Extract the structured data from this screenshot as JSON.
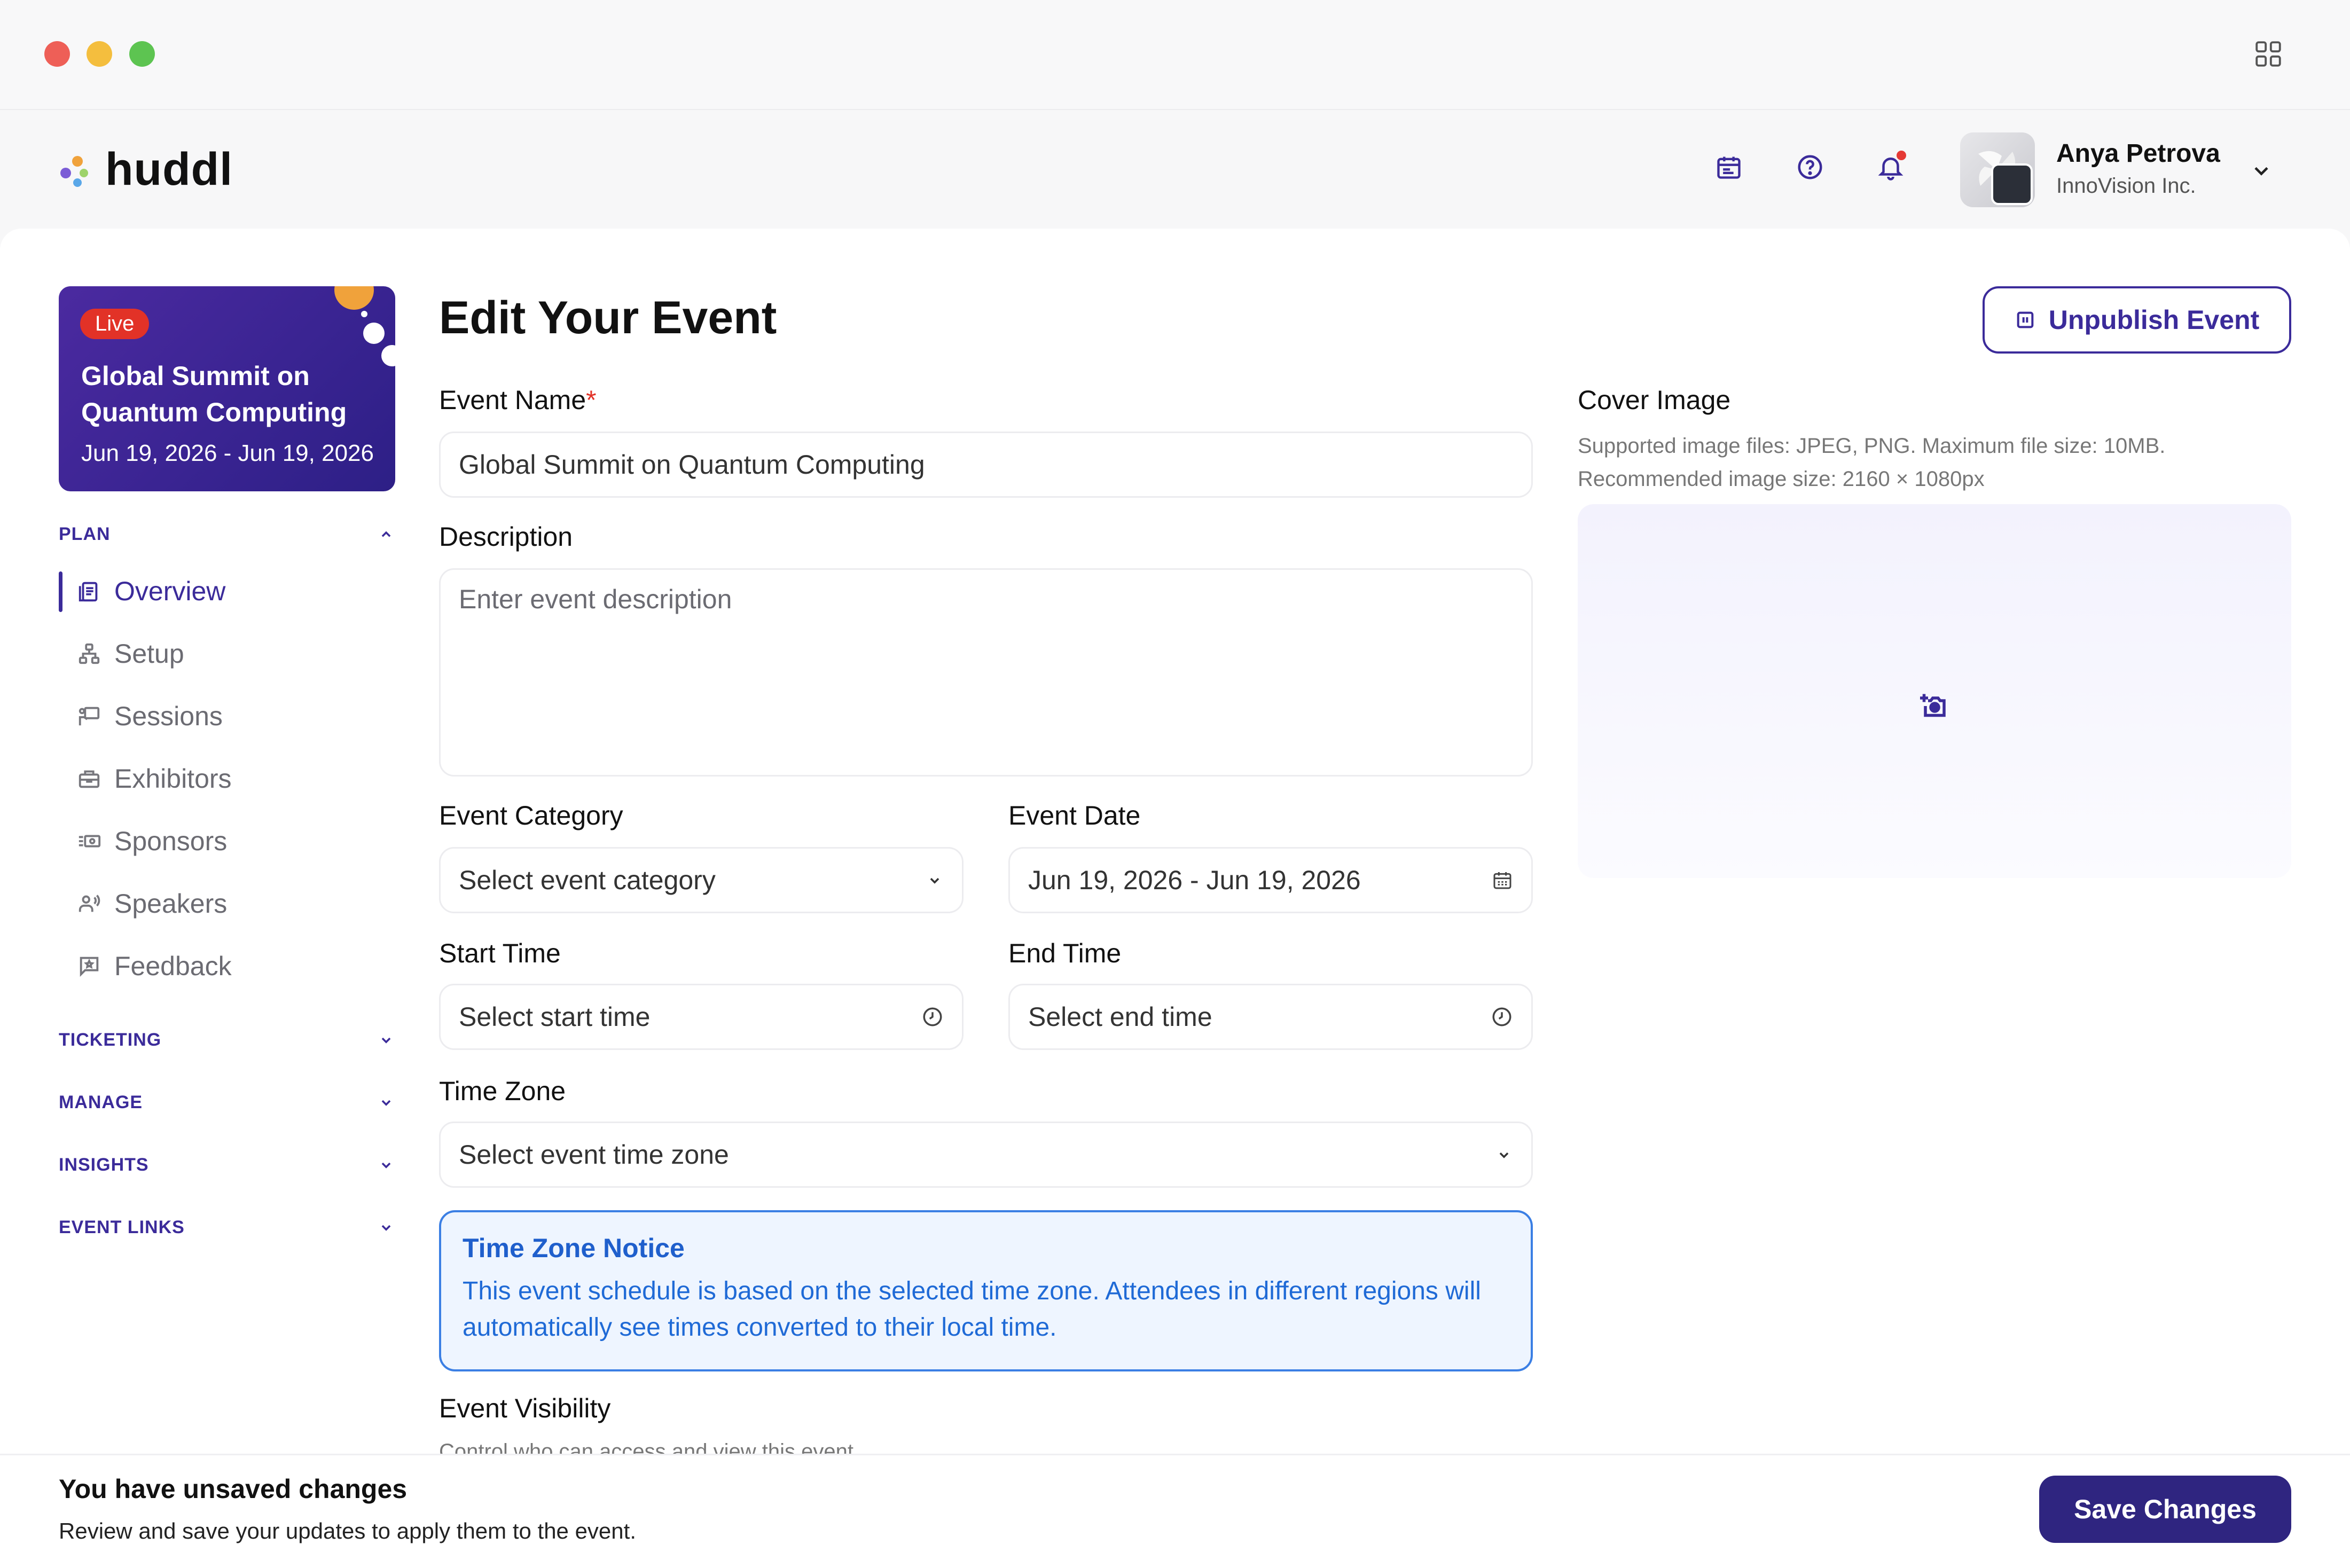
{
  "colors": {
    "accent": "#3b2b9a",
    "live": "#e23227",
    "notice_border": "#3b7fe4",
    "notice_bg": "#eef5ff"
  },
  "brand": {
    "name": "huddl"
  },
  "user": {
    "name": "Anya Petrova",
    "org": "InnoVision Inc."
  },
  "event_card": {
    "badge": "Live",
    "title": "Global Summit on Quantum Computing",
    "date": "Jun 19, 2026 - Jun 19, 2026"
  },
  "sidebar": {
    "plan_label": "PLAN",
    "items": [
      {
        "label": "Overview",
        "icon": "clipboard-icon",
        "active": true
      },
      {
        "label": "Setup",
        "icon": "sitemap-icon"
      },
      {
        "label": "Sessions",
        "icon": "presentation-icon"
      },
      {
        "label": "Exhibitors",
        "icon": "booth-icon"
      },
      {
        "label": "Sponsors",
        "icon": "money-icon"
      },
      {
        "label": "Speakers",
        "icon": "speaker-icon"
      },
      {
        "label": "Feedback",
        "icon": "feedback-icon"
      }
    ],
    "sections": [
      "TICKETING",
      "MANAGE",
      "INSIGHTS",
      "EVENT LINKS"
    ]
  },
  "form": {
    "title": "Edit Your Event",
    "unpublish_label": "Unpublish Event",
    "event_name_label": "Event Name",
    "required_mark": "*",
    "event_name_value": "Global Summit on Quantum Computing",
    "description_label": "Description",
    "description_placeholder": "Enter event description",
    "category_label": "Event Category",
    "category_placeholder": "Select event category",
    "date_label": "Event Date",
    "date_value": "Jun 19, 2026 - Jun 19, 2026",
    "start_label": "Start Time",
    "start_placeholder": "Select start time",
    "end_label": "End Time",
    "end_placeholder": "Select end time",
    "timezone_label": "Time Zone",
    "timezone_placeholder": "Select event time zone",
    "notice_title": "Time Zone Notice",
    "notice_body": "This event schedule is based on the selected time zone. Attendees in different regions will automatically see times converted to their local time.",
    "visibility_label": "Event Visibility",
    "visibility_sub": "Control who can access and view this event"
  },
  "cover": {
    "label": "Cover Image",
    "help_line1": "Supported image files: JPEG, PNG. Maximum file size: 10MB.",
    "help_line2": "Recommended image size: 2160 × 1080px"
  },
  "footer": {
    "title": "You have unsaved changes",
    "desc": "Review and save your updates to apply them to the event.",
    "save_label": "Save Changes"
  }
}
